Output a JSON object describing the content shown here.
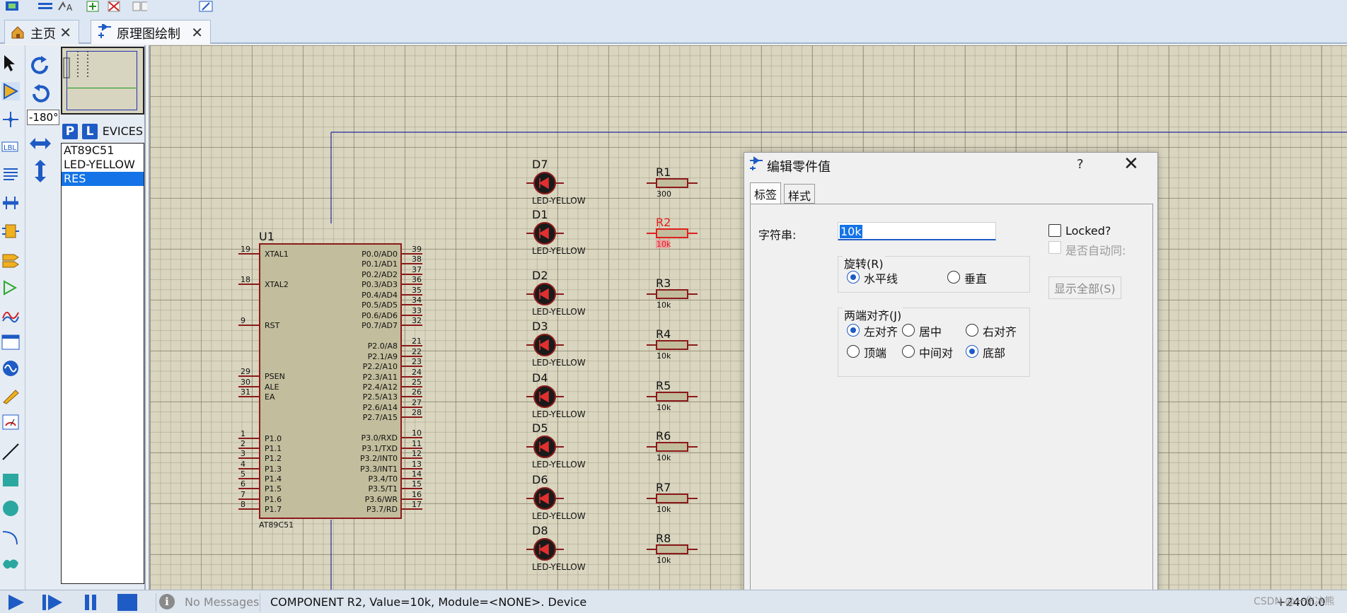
{
  "tabs": [
    {
      "label": "主页"
    },
    {
      "label": "原理图绘制"
    }
  ],
  "rotation_input": {
    "value": "-180°"
  },
  "device_panel": {
    "p_button": "P",
    "l_button": "L",
    "label": "DEVICES",
    "items": [
      "AT89C51",
      "LED-YELLOW",
      "RES"
    ],
    "selected": "RES"
  },
  "schematic": {
    "mcu": {
      "ref": "U1",
      "part": "AT89C51",
      "left_pins": [
        {
          "num": "19",
          "name": "XTAL1"
        },
        {
          "num": "18",
          "name": "XTAL2"
        },
        {
          "num": "9",
          "name": "RST"
        },
        {
          "num": "29",
          "name": "PSEN"
        },
        {
          "num": "30",
          "name": "ALE"
        },
        {
          "num": "31",
          "name": "EA"
        },
        {
          "num": "1",
          "name": "P1.0"
        },
        {
          "num": "2",
          "name": "P1.1"
        },
        {
          "num": "3",
          "name": "P1.2"
        },
        {
          "num": "4",
          "name": "P1.3"
        },
        {
          "num": "5",
          "name": "P1.4"
        },
        {
          "num": "6",
          "name": "P1.5"
        },
        {
          "num": "7",
          "name": "P1.6"
        },
        {
          "num": "8",
          "name": "P1.7"
        }
      ],
      "right_pins": [
        {
          "num": "39",
          "name": "P0.0/AD0"
        },
        {
          "num": "38",
          "name": "P0.1/AD1"
        },
        {
          "num": "37",
          "name": "P0.2/AD2"
        },
        {
          "num": "36",
          "name": "P0.3/AD3"
        },
        {
          "num": "35",
          "name": "P0.4/AD4"
        },
        {
          "num": "34",
          "name": "P0.5/AD5"
        },
        {
          "num": "33",
          "name": "P0.6/AD6"
        },
        {
          "num": "32",
          "name": "P0.7/AD7"
        },
        {
          "num": "21",
          "name": "P2.0/A8"
        },
        {
          "num": "22",
          "name": "P2.1/A9"
        },
        {
          "num": "23",
          "name": "P2.2/A10"
        },
        {
          "num": "24",
          "name": "P2.3/A11"
        },
        {
          "num": "25",
          "name": "P2.4/A12"
        },
        {
          "num": "26",
          "name": "P2.5/A13"
        },
        {
          "num": "27",
          "name": "P2.6/A14"
        },
        {
          "num": "28",
          "name": "P2.7/A15"
        },
        {
          "num": "10",
          "name": "P3.0/RXD"
        },
        {
          "num": "11",
          "name": "P3.1/TXD"
        },
        {
          "num": "12",
          "name": "P3.2/INT0"
        },
        {
          "num": "13",
          "name": "P3.3/INT1"
        },
        {
          "num": "14",
          "name": "P3.4/T0"
        },
        {
          "num": "15",
          "name": "P3.5/T1"
        },
        {
          "num": "16",
          "name": "P3.6/WR"
        },
        {
          "num": "17",
          "name": "P3.7/RD"
        }
      ]
    },
    "leds": [
      {
        "ref": "D7",
        "part": "LED-YELLOW"
      },
      {
        "ref": "D1",
        "part": "LED-YELLOW"
      },
      {
        "ref": "D2",
        "part": "LED-YELLOW"
      },
      {
        "ref": "D3",
        "part": "LED-YELLOW"
      },
      {
        "ref": "D4",
        "part": "LED-YELLOW"
      },
      {
        "ref": "D5",
        "part": "LED-YELLOW"
      },
      {
        "ref": "D6",
        "part": "LED-YELLOW"
      },
      {
        "ref": "D8",
        "part": "LED-YELLOW"
      }
    ],
    "resistors": [
      {
        "ref": "R1",
        "value": "300",
        "selected": false
      },
      {
        "ref": "R2",
        "value": "10k",
        "selected": true
      },
      {
        "ref": "R3",
        "value": "10k",
        "selected": false
      },
      {
        "ref": "R4",
        "value": "10k",
        "selected": false
      },
      {
        "ref": "R5",
        "value": "10k",
        "selected": false
      },
      {
        "ref": "R6",
        "value": "10k",
        "selected": false
      },
      {
        "ref": "R7",
        "value": "10k",
        "selected": false
      },
      {
        "ref": "R8",
        "value": "10k",
        "selected": false
      }
    ],
    "colors": {
      "pin": "#8b1a1a",
      "body": "#c2bd9c",
      "wire": "#2a2a9a",
      "selected": "#e02020",
      "led": "#1a1a1a",
      "text": "#111111"
    }
  },
  "dialog": {
    "title": "编辑零件值",
    "help": "?",
    "close": "✕",
    "tabs": [
      "标签",
      "样式"
    ],
    "string_label": "字符串:",
    "string_value": "10k",
    "locked_label": "Locked?",
    "auto_label": "是否自动同:",
    "show_all_button": "显示全部(S)",
    "rotation": {
      "title": "旋转(R)",
      "options": [
        "水平线",
        "垂直"
      ],
      "selected": "水平线"
    },
    "justify": {
      "title": "两端对齐(J)",
      "options": [
        "左对齐",
        "居中",
        "右对齐",
        "顶端",
        "中间对",
        "底部"
      ],
      "selected": [
        "左对齐",
        "底部"
      ]
    }
  },
  "statusbar": {
    "messages": "No Messages",
    "info_icon": "i",
    "text": "COMPONENT R2, Value=10k, Module=<NONE>. Device",
    "coord": "+2400.0",
    "watermark": "CSDN @一化冰熊"
  }
}
